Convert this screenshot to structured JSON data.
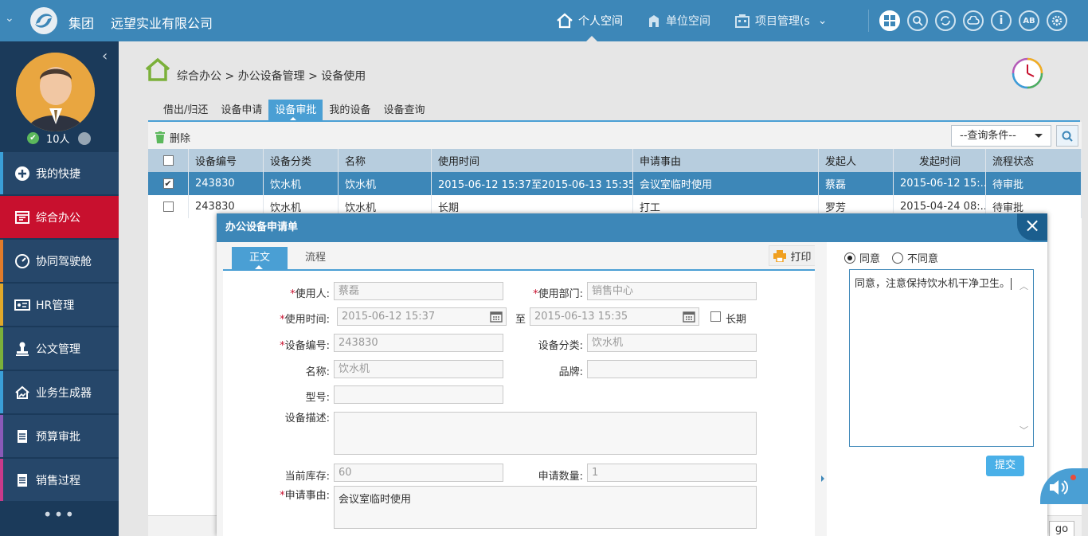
{
  "header": {
    "group": "集团",
    "company": "远望实业有限公司",
    "nav": [
      {
        "label": "个人空间",
        "icon": "home-icon",
        "active": true
      },
      {
        "label": "单位空间",
        "icon": "building-icon",
        "active": false
      },
      {
        "label": "项目管理(s",
        "icon": "project-icon",
        "active": false
      }
    ],
    "tool_icons": [
      "grid-icon",
      "search-icon",
      "refresh-icon",
      "cloud-icon",
      "info-icon",
      "ab-icon",
      "gear-icon"
    ],
    "ab_label": "AB"
  },
  "sidebar": {
    "online_count": "10人",
    "items": [
      {
        "label": "我的快捷",
        "icon": "plus-circle-icon",
        "accent": "#3a9fd8",
        "active": false
      },
      {
        "label": "综合办公",
        "icon": "office-icon",
        "accent": "#c8102e",
        "active": true
      },
      {
        "label": "协同驾驶舱",
        "icon": "dashboard-icon",
        "accent": "#e07b2a",
        "active": false
      },
      {
        "label": "HR管理",
        "icon": "idcard-icon",
        "accent": "#e0a82a",
        "active": false
      },
      {
        "label": "公文管理",
        "icon": "stamp-icon",
        "accent": "#7bb03a",
        "active": false
      },
      {
        "label": "业务生成器",
        "icon": "chart-home-icon",
        "accent": "#3a9fd8",
        "active": false
      },
      {
        "label": "预算审批",
        "icon": "document-icon",
        "accent": "#8a5ab8",
        "active": false
      },
      {
        "label": "销售过程",
        "icon": "document-icon",
        "accent": "#c83a8a",
        "active": false
      }
    ],
    "more": "•••"
  },
  "breadcrumb": "综合办公 > 办公设备管理 > 设备使用",
  "tabs": [
    {
      "label": "借出/归还",
      "active": false
    },
    {
      "label": "设备申请",
      "active": false
    },
    {
      "label": "设备审批",
      "active": true
    },
    {
      "label": "我的设备",
      "active": false
    },
    {
      "label": "设备查询",
      "active": false
    }
  ],
  "toolbar": {
    "delete_label": "删除",
    "query_placeholder": "--查询条件--"
  },
  "table": {
    "columns": [
      "设备编号",
      "设备分类",
      "名称",
      "使用时间",
      "申请事由",
      "发起人",
      "发起时间",
      "流程状态"
    ],
    "rows": [
      {
        "checked": true,
        "cells": [
          "243830",
          "饮水机",
          "饮水机",
          "2015-06-12 15:37至2015-06-13 15:35",
          "会议室临时使用",
          "蔡磊",
          "2015-06-12 15:...",
          "待审批"
        ]
      },
      {
        "checked": false,
        "cells": [
          "243830",
          "饮水机",
          "饮水机",
          "长期",
          "打工",
          "罗芳",
          "2015-04-24 08:...",
          "待审批"
        ]
      }
    ]
  },
  "pager": {
    "go_label": "go"
  },
  "dialog": {
    "title": "办公设备申请单",
    "tab_main": "正文",
    "tab_flow": "流程",
    "print_label": "打印",
    "fields": {
      "user_label": "使用人:",
      "user_value": "蔡磊",
      "dept_label": "使用部门:",
      "dept_value": "销售中心",
      "time_label": "使用时间:",
      "time_start": "2015-06-12 15:37",
      "time_to": "至",
      "time_end": "2015-06-13 15:35",
      "longterm_label": "长期",
      "code_label": "设备编号:",
      "code_value": "243830",
      "category_label": "设备分类:",
      "category_value": "饮水机",
      "name_label": "名称:",
      "name_value": "饮水机",
      "brand_label": "品牌:",
      "brand_value": "",
      "model_label": "型号:",
      "model_value": "",
      "desc_label": "设备描述:",
      "desc_value": "",
      "stock_label": "当前库存:",
      "stock_value": "60",
      "qty_label": "申请数量:",
      "qty_value": "1",
      "reason_label": "申请事由:",
      "reason_value": "会议室临时使用"
    },
    "approve_label": "同意",
    "reject_label": "不同意",
    "opinion": "同意，注意保持饮水机干净卫生。",
    "submit_label": "提交"
  }
}
